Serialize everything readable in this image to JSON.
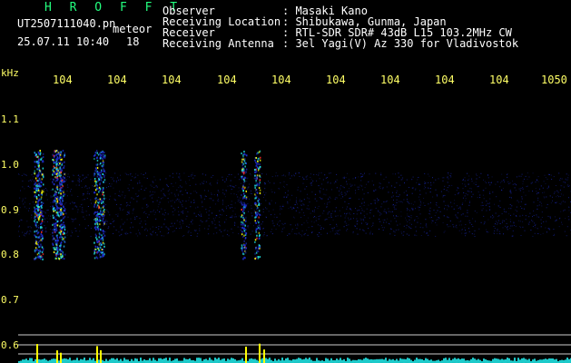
{
  "header": {
    "title": "H R O F F T",
    "filename": "UT2507111040.pn",
    "meteor_label": "meteor",
    "date": "25.07.11 10:40",
    "count": "18",
    "observer_label": "Observer",
    "observer_value": ": Masaki Kano",
    "location_label": "Receiving Location",
    "location_value": ": Shibukawa, Gunma, Japan",
    "receiver_label": "Receiver",
    "receiver_value": ": RTL-SDR SDR# 43dB L15 103.2MHz CW",
    "antenna_label": "Receiving Antenna",
    "antenna_value": ": 3el Yagi(V) Az 330 for Vladivostok"
  },
  "axis": {
    "y_unit": "kHz",
    "x_ticks": [
      "104",
      "104",
      "104",
      "104",
      "104",
      "104",
      "104",
      "104",
      "104",
      "1050"
    ],
    "y_ticks": [
      "1.1",
      "1.0",
      "0.9",
      "0.8",
      "0.7",
      "0.6"
    ]
  },
  "colors": {
    "background": "#000000",
    "title": "#23ff7f",
    "tick_label": "#ffff66",
    "baseline_line": "#cccccc",
    "signal_low": "#1f2fd0",
    "signal_mid": "#20e0e0",
    "signal_high": "#ffff00",
    "signal_peak": "#ff3030"
  }
}
